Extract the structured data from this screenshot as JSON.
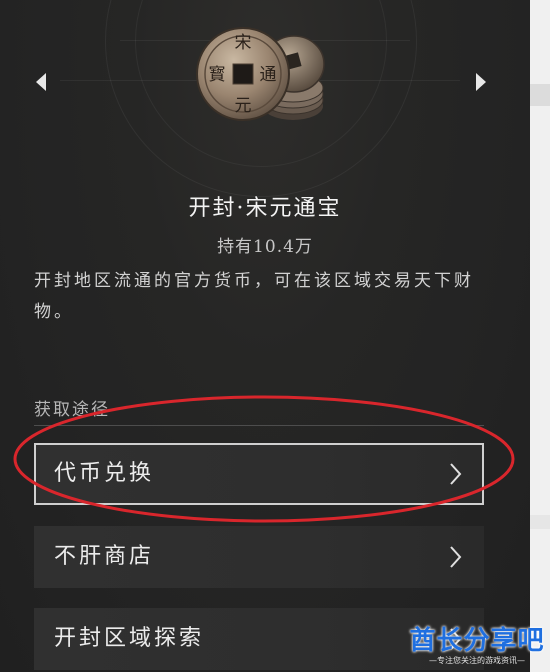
{
  "item": {
    "title": "开封·宋元通宝",
    "holding": "持有10.4万",
    "description": "开封地区流通的官方货币，可在该区域交易天下财物。",
    "coin_characters": [
      "宋",
      "通",
      "元",
      "寳"
    ]
  },
  "navigation": {
    "prev_icon": "chevron-left-icon",
    "next_icon": "chevron-right-icon"
  },
  "sources": {
    "label": "获取途径",
    "items": [
      {
        "label": "代币兑换",
        "selected": true
      },
      {
        "label": "不肝商店",
        "selected": false
      },
      {
        "label": "开封区域探索",
        "selected": false
      }
    ]
  },
  "annotation": {
    "color": "#d9262c"
  },
  "watermark": {
    "main": "酋长分享吧",
    "sub": "—专注您关注的游戏资讯—"
  }
}
